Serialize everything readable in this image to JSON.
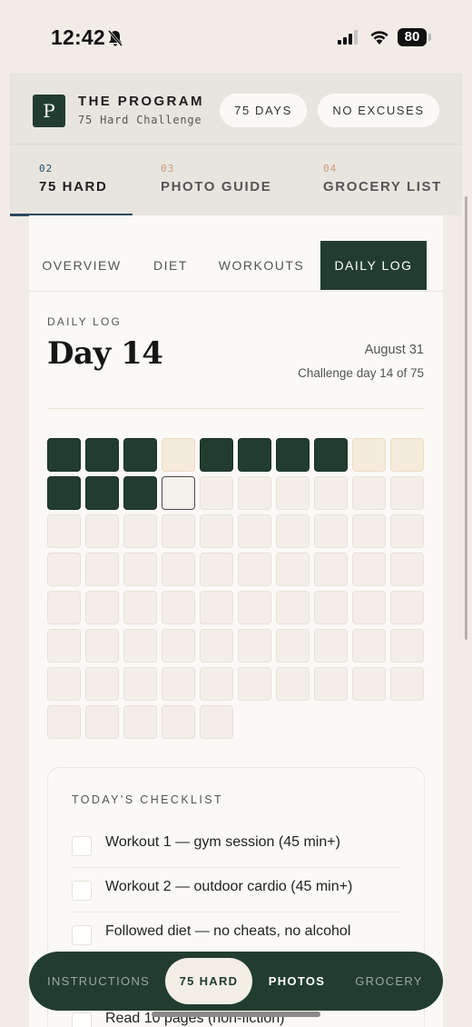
{
  "status_bar": {
    "time": "12:42",
    "battery": "80",
    "icons": [
      "bell-slash-icon",
      "signal-icon",
      "wifi-icon",
      "battery-icon"
    ]
  },
  "header": {
    "logo_letter": "P",
    "title": "THE PROGRAM",
    "subtitle": "75 Hard Challenge",
    "pills": [
      "75 DAYS",
      "NO EXCUSES"
    ]
  },
  "section_tabs": [
    {
      "num": "02",
      "label": "75 HARD",
      "active": true
    },
    {
      "num": "03",
      "label": "PHOTO GUIDE",
      "active": false
    },
    {
      "num": "04",
      "label": "GROCERY LIST",
      "active": false
    }
  ],
  "subtabs": [
    {
      "label": "OVERVIEW",
      "active": false
    },
    {
      "label": "DIET",
      "active": false
    },
    {
      "label": "WORKOUTS",
      "active": false
    },
    {
      "label": "DAILY LOG",
      "active": true
    }
  ],
  "daily_log": {
    "eyebrow": "DAILY LOG",
    "title": "Day 14",
    "date": "August 31",
    "progress": "Challenge day 14 of 75",
    "total_days": 75,
    "current_day": 14,
    "day_status": [
      "done",
      "done",
      "done",
      "missed",
      "done",
      "done",
      "done",
      "done",
      "missed",
      "missed",
      "done",
      "done",
      "done",
      "today"
    ]
  },
  "checklist": {
    "title": "TODAY'S CHECKLIST",
    "items": [
      {
        "label": "Workout 1 — gym session (45 min+)",
        "checked": false
      },
      {
        "label": "Workout 2 — outdoor cardio (45 min+)",
        "checked": false
      },
      {
        "label": "Followed diet — no cheats, no alcohol",
        "checked": false
      },
      {
        "label": "Read 10 pages (non-fiction)",
        "checked": false
      }
    ]
  },
  "bottom_nav": [
    {
      "label": "INSTRUCTIONS",
      "active": false
    },
    {
      "label": "75 HARD",
      "active": true
    },
    {
      "label": "PHOTOS",
      "active": false
    },
    {
      "label": "GROCERY",
      "active": false
    }
  ],
  "colors": {
    "accent": "#223d2f",
    "background": "#f1ede6",
    "card": "#faf9f6",
    "missed": "#f5ebdc"
  }
}
